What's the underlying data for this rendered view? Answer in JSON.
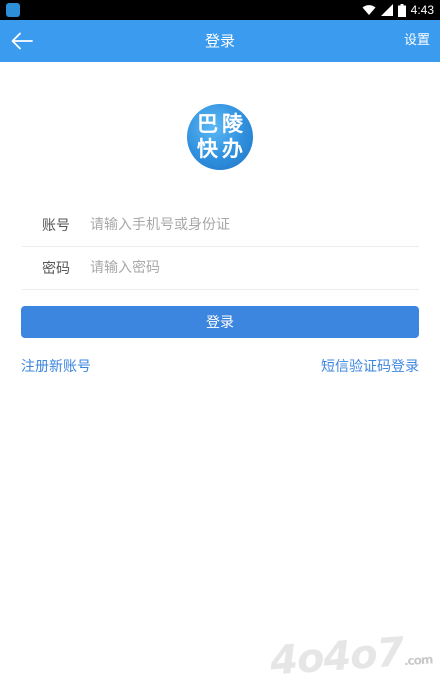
{
  "status_bar": {
    "time": "4:43",
    "icons": [
      "wifi-icon",
      "signal-icon",
      "battery-icon"
    ]
  },
  "header": {
    "title": "登录",
    "settings_label": "设置",
    "back_icon": "arrow-left-icon",
    "background_color": "#3a9bef"
  },
  "logo": {
    "chars": [
      "巴",
      "陵",
      "快",
      "办"
    ]
  },
  "form": {
    "account_label": "账号",
    "account_placeholder": "请输入手机号或身份证",
    "account_value": "",
    "password_label": "密码",
    "password_placeholder": "请输入密码",
    "password_value": ""
  },
  "login_button": {
    "label": "登录",
    "color": "#3d86e0"
  },
  "links": {
    "register": "注册新账号",
    "sms_login": "短信验证码登录"
  },
  "watermark": {
    "text": "4o4o7",
    "suffix": ".com"
  }
}
